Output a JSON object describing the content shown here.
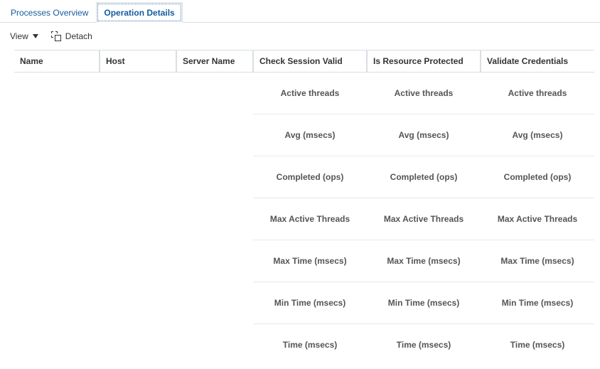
{
  "tabs": [
    {
      "label": "Processes Overview",
      "active": false
    },
    {
      "label": "Operation Details",
      "active": true
    }
  ],
  "toolbar": {
    "view_label": "View",
    "detach_label": "Detach"
  },
  "columns": {
    "name": "Name",
    "host": "Host",
    "server": "Server Name",
    "c1": "Check Session Valid",
    "c2": "Is Resource Protected",
    "c3": "Validate Credentials"
  },
  "metrics": [
    "Active threads",
    "Avg (msecs)",
    "Completed (ops)",
    "Max Active Threads",
    "Max Time (msecs)",
    "Min Time (msecs)",
    "Time (msecs)"
  ]
}
